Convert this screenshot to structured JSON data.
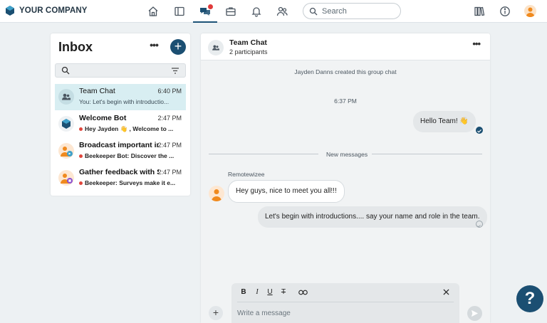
{
  "brand": {
    "name": "YOUR COMPANY"
  },
  "topnav": {
    "icons": [
      "home-icon",
      "news-icon",
      "chat-icon",
      "workspaces-icon",
      "bell-icon",
      "people-icon"
    ],
    "search_placeholder": "Search",
    "right_icons": [
      "library-icon",
      "info-icon",
      "user-avatar"
    ],
    "accent": "#1b4f72",
    "notification_dot": "#e03a3a"
  },
  "inbox": {
    "title": "Inbox",
    "more_label": "•••",
    "add_label": "+",
    "conversations": [
      {
        "title": "Team Chat",
        "time": "6:40 PM",
        "preview": "You: Let's begin with introductio...",
        "unread": false,
        "active": true
      },
      {
        "title": "Welcome Bot",
        "time": "2:47 PM",
        "preview": "Hey Jayden 👋 , Welcome to ...",
        "unread": true,
        "active": false
      },
      {
        "title": "Broadcast important inf...",
        "time": "2:47 PM",
        "preview": "Beekeeper Bot: Discover the ...",
        "unread": true,
        "active": false
      },
      {
        "title": "Gather feedback with S...",
        "time": "2:47 PM",
        "preview": "Beekeeper: Surveys make it e...",
        "unread": true,
        "active": false
      }
    ]
  },
  "chat": {
    "title": "Team Chat",
    "subtitle": "2 participants",
    "more_label": "•••",
    "system_created": "Jayden Danns created this group chat",
    "time_marker": "6:37 PM",
    "outgoing_1": "Hello Team! 👋",
    "new_messages_label": "New messages",
    "incoming_sender": "Remotewizee",
    "incoming_1": "Hey guys, nice to meet you all!!!",
    "outgoing_2": "Let's begin with introductions.... say your name and role in the team.",
    "composer": {
      "placeholder": "Write a message",
      "bold": "B",
      "italic": "I",
      "underline": "U",
      "strike": "T",
      "add": "+"
    }
  },
  "help": {
    "label": "?"
  }
}
